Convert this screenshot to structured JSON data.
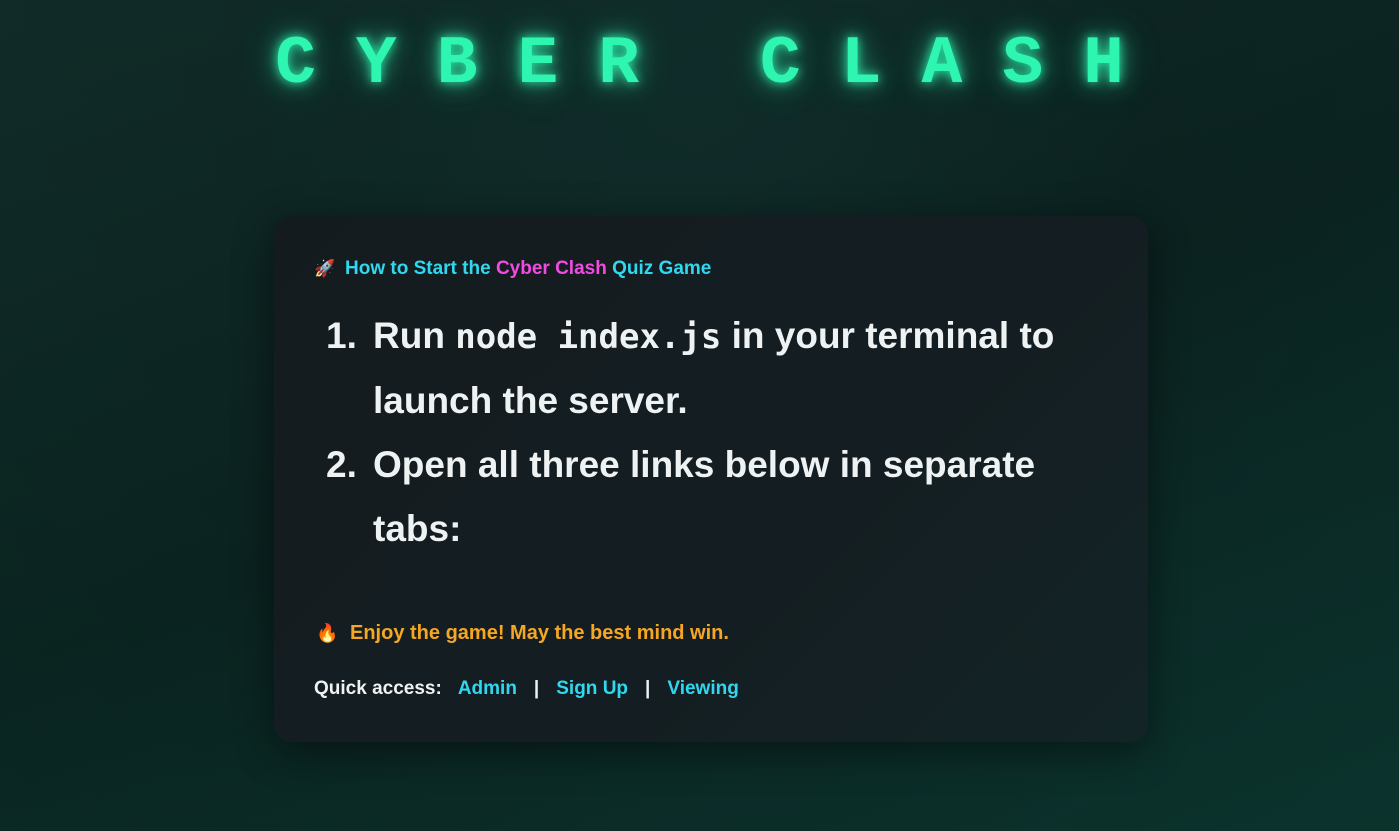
{
  "app": {
    "title": "CYBER CLASH"
  },
  "card": {
    "heading": {
      "icon": "rocket-icon",
      "prefix": "How to Start the",
      "accent": "Cyber Clash",
      "suffix": "Quiz Game"
    },
    "steps": [
      {
        "number": "1.",
        "before": "Run",
        "code": "node index.js",
        "after": "in your terminal to launch the server."
      },
      {
        "number": "2.",
        "text": "Open all three links below in separate tabs:"
      }
    ],
    "enjoy": {
      "icon": "fire-icon",
      "text": "Enjoy the game! May the best mind win."
    },
    "quick_access": {
      "label": "Quick access:",
      "links": [
        "Admin",
        "Sign Up",
        "Viewing"
      ],
      "separator": "|"
    }
  },
  "colors": {
    "title_glow": "#2ef5b0",
    "heading": "#2fd8ee",
    "accent": "#f04ce2",
    "enjoy": "#f5a623",
    "link": "#2fd8ee",
    "card_bg": "#141b1f",
    "page_bg": "#0c2421"
  }
}
